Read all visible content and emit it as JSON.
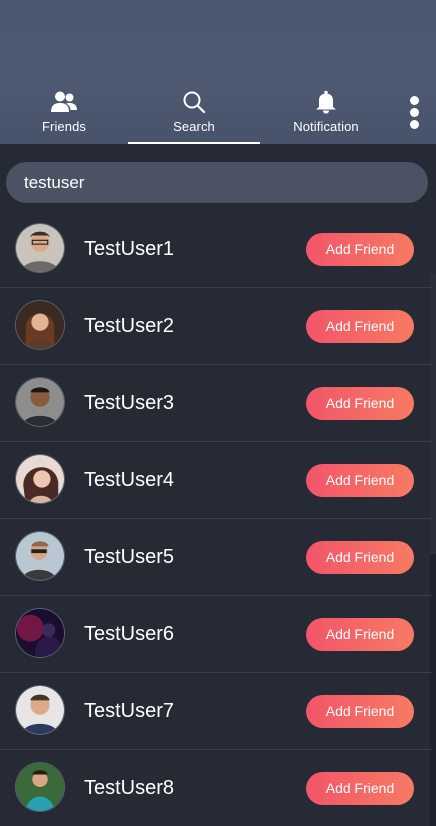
{
  "tabs": [
    {
      "label": "Friends",
      "icon": "people-icon"
    },
    {
      "label": "Search",
      "icon": "search-icon"
    },
    {
      "label": "Notification",
      "icon": "bell-icon"
    }
  ],
  "active_tab": "Search",
  "search": {
    "value": "testuser"
  },
  "users": [
    {
      "name": "TestUser1",
      "action": "Add Friend"
    },
    {
      "name": "TestUser2",
      "action": "Add Friend"
    },
    {
      "name": "TestUser3",
      "action": "Add Friend"
    },
    {
      "name": "TestUser4",
      "action": "Add Friend"
    },
    {
      "name": "TestUser5",
      "action": "Add Friend"
    },
    {
      "name": "TestUser6",
      "action": "Add Friend"
    },
    {
      "name": "TestUser7",
      "action": "Add Friend"
    },
    {
      "name": "TestUser8",
      "action": "Add Friend"
    }
  ],
  "colors": {
    "header": "#4d5a71",
    "background": "#252a35",
    "accent_start": "#f2556a",
    "accent_end": "#f77a63"
  }
}
